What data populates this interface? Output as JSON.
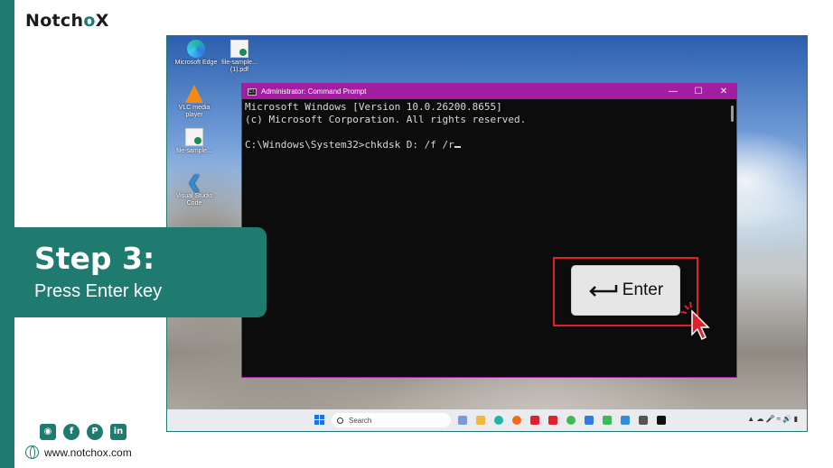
{
  "brand": {
    "name_prefix": "Notch",
    "name_mark": "o",
    "name_suffix": "X"
  },
  "desktop_icons": [
    {
      "label": "Microsoft Edge",
      "icon": "edge-icon"
    },
    {
      "label": "file-sample...(1).pdf",
      "icon": "pdf-file-icon"
    },
    {
      "label": "VLC media player",
      "icon": "vlc-icon"
    },
    {
      "label": "file-sample...",
      "icon": "pdf-file-icon"
    },
    {
      "label": "Visual Studio Code",
      "icon": "vscode-icon"
    }
  ],
  "cmd_window": {
    "title": "Administrator: Command Prompt",
    "lines": [
      "Microsoft Windows [Version 10.0.26200.8655]",
      "(c) Microsoft Corporation. All rights reserved.",
      "",
      "C:\\Windows\\System32>chkdsk D: /f /r"
    ],
    "minimize": "—",
    "maximize": "☐",
    "close": "✕"
  },
  "enter_key": {
    "label": "Enter"
  },
  "taskbar": {
    "search_placeholder": "Search"
  },
  "step": {
    "title": "Step 3:",
    "subtitle": "Press Enter key"
  },
  "socials": [
    "instagram-icon",
    "facebook-icon",
    "pinterest-icon",
    "linkedin-icon"
  ],
  "website": "www.notchox.com",
  "colors": {
    "brand_teal": "#1f7a6f",
    "highlight_red": "#e2202b",
    "cmd_title_magenta": "#a11ea1"
  }
}
